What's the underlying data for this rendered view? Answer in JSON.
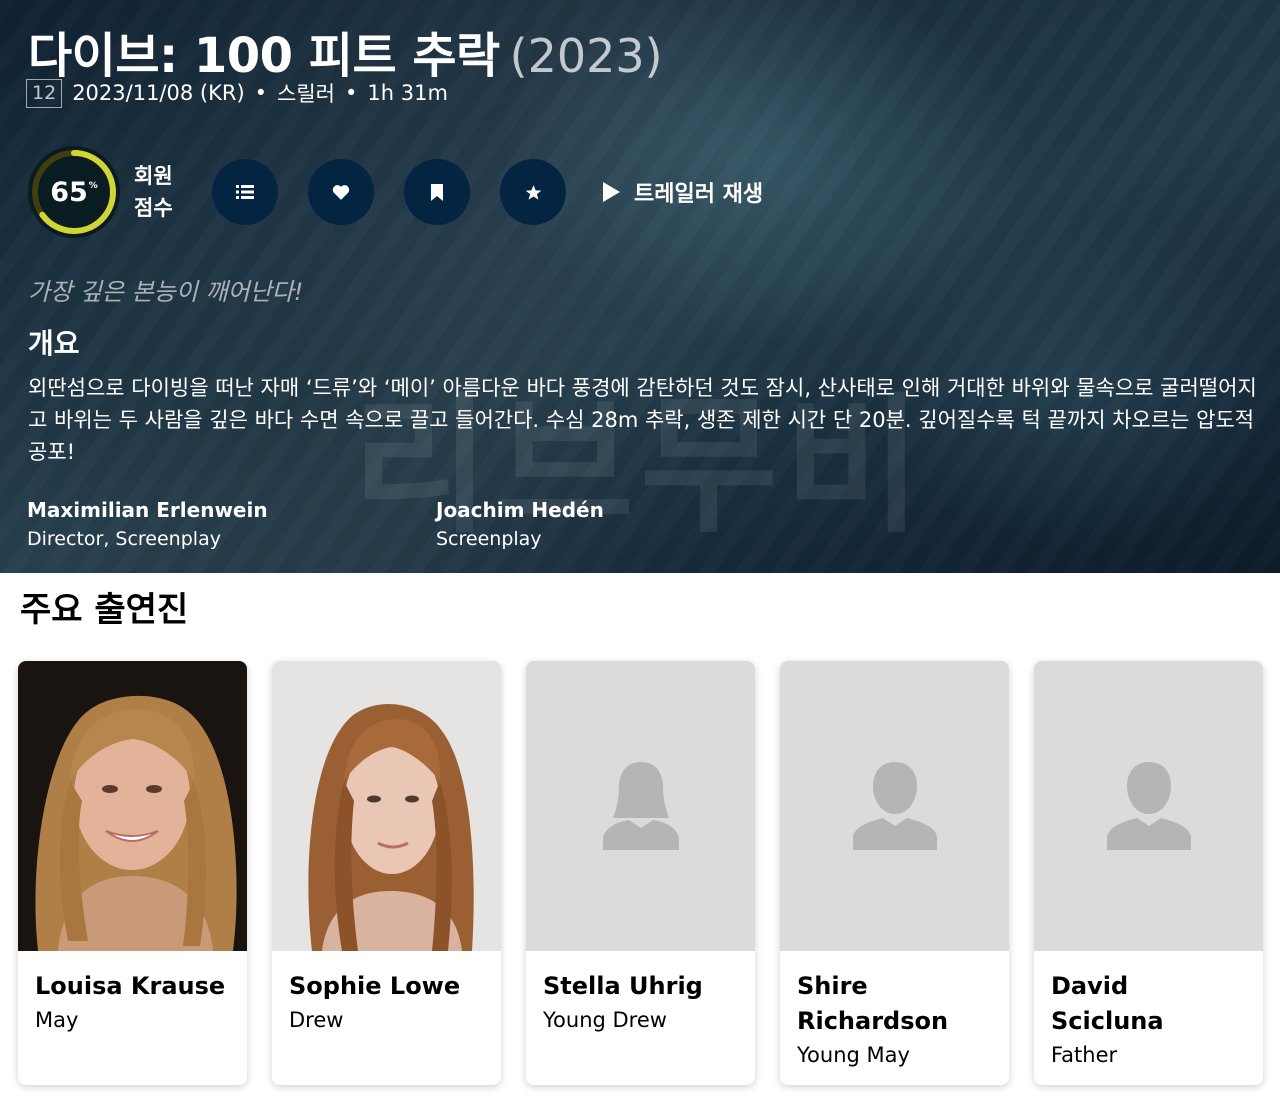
{
  "movie": {
    "title": "다이브: 100 피트 추락",
    "year": "(2023)",
    "certification": "12",
    "release": "2023/11/08 (KR)",
    "genre": "스릴러",
    "runtime": "1h 31m",
    "score": 65,
    "score_display": "65",
    "score_unit": "%",
    "score_label_1": "회원",
    "score_label_2": "점수",
    "trailer_label": "트레일러 재생",
    "tagline": "가장 깊은 본능이 깨어난다!",
    "overview_heading": "개요",
    "overview": "외딴섬으로 다이빙을 떠난 자매 ‘드류’와 ‘메이’ 아름다운 바다 풍경에 감탄하던 것도 잠시, 산사태로 인해 거대한 바위와 물속으로 굴러떨어지고 바위는 두 사람을 깊은 바다 수면 속으로 끌고 들어간다. 수심 28m 추락, 생존 제한 시간 단 20분. 깊어질수록 턱 끝까지 차오르는 압도적 공포!",
    "watermark": "리브무비"
  },
  "crew": [
    {
      "name": "Maximilian Erlenwein",
      "job": "Director, Screenplay"
    },
    {
      "name": "Joachim Hedén",
      "job": "Screenplay"
    }
  ],
  "cast_heading": "주요 출연진",
  "cast": [
    {
      "name": "Louisa Krause",
      "character": "May",
      "photo": "portrait-photo"
    },
    {
      "name": "Sophie Lowe",
      "character": "Drew",
      "photo": "portrait-photo"
    },
    {
      "name": "Stella Uhrig",
      "character": "Young Drew",
      "photo": "female-placeholder-icon"
    },
    {
      "name": "Shire Richardson",
      "character": "Young May",
      "photo": "male-placeholder-icon"
    },
    {
      "name": "David Scicluna",
      "character": "Father",
      "photo": "male-placeholder-icon"
    }
  ],
  "colors": {
    "score_ring": "#d2d531",
    "score_track": "#423d0f",
    "button_bg": "#032541"
  }
}
